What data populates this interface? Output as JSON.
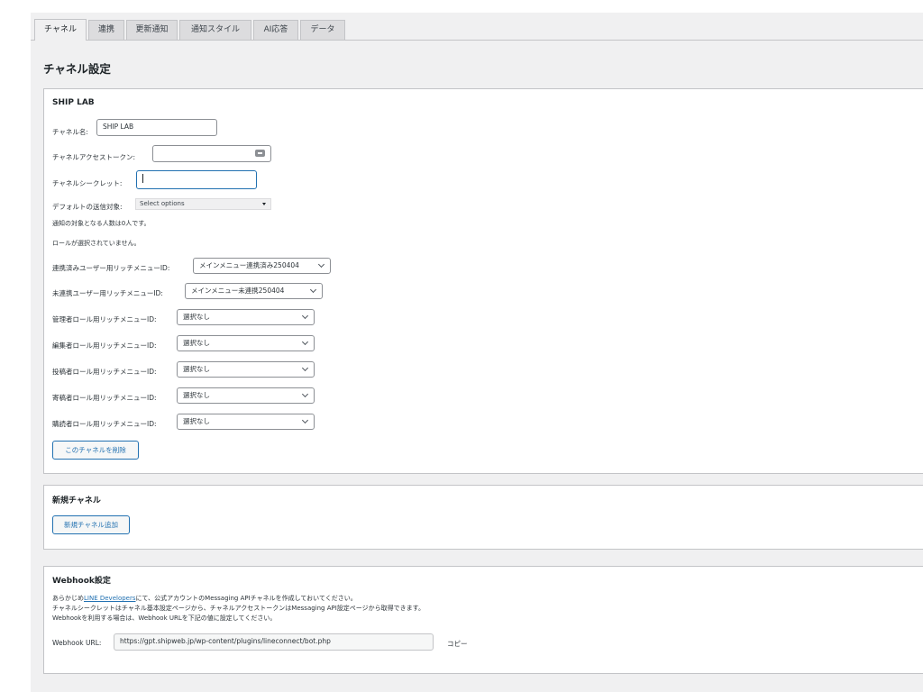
{
  "tabs": [
    "チャネル",
    "連携",
    "更新通知",
    "通知スタイル",
    "AI応答",
    "データ"
  ],
  "page_title": "チャネル設定",
  "channel": {
    "title": "SHIP LAB",
    "name_label": "チャネル名:",
    "name_value": "SHIP LAB",
    "token_label": "チャネルアクセストークン:",
    "token_value": "",
    "secret_label": "チャネルシークレット:",
    "secret_value": "",
    "default_target_label": "デフォルトの送信対象:",
    "default_target_value": "Select options",
    "info1": "通知の対象となる人数は0人です。",
    "info2": "ロールが選択されていません。",
    "menus": [
      {
        "label": "連携済みユーザー用リッチメニューID:",
        "value": "メインメニュー連携済み250404"
      },
      {
        "label": "未連携ユーザー用リッチメニューID:",
        "value": "メインメニュー未連携250404"
      },
      {
        "label": "管理者ロール用リッチメニューID:",
        "value": "選択なし"
      },
      {
        "label": "編集者ロール用リッチメニューID:",
        "value": "選択なし"
      },
      {
        "label": "投稿者ロール用リッチメニューID:",
        "value": "選択なし"
      },
      {
        "label": "寄稿者ロール用リッチメニューID:",
        "value": "選択なし"
      },
      {
        "label": "購読者ロール用リッチメニューID:",
        "value": "選択なし"
      }
    ],
    "delete_button": "このチャネルを削除"
  },
  "new_channel": {
    "title": "新規チャネル",
    "add_button": "新規チャネル追加"
  },
  "webhook": {
    "title": "Webhook設定",
    "line1_pre": "あらかじめ",
    "line1_link": "LINE Developers",
    "line1_post": "にて、公式アカウントのMessaging APIチャネルを作成しておいてください。",
    "line2": "チャネルシークレットはチャネル基本設定ページから、チャネルアクセストークンはMessaging API設定ページから取得できます。",
    "line3": "Webhookを利用する場合は、Webhook URLを下記の値に設定してください。",
    "url_label": "Webhook URL:",
    "url_value": "https://gpt.shipweb.jp/wp-content/plugins/lineconnect/bot.php",
    "copy_label": "コピー"
  }
}
